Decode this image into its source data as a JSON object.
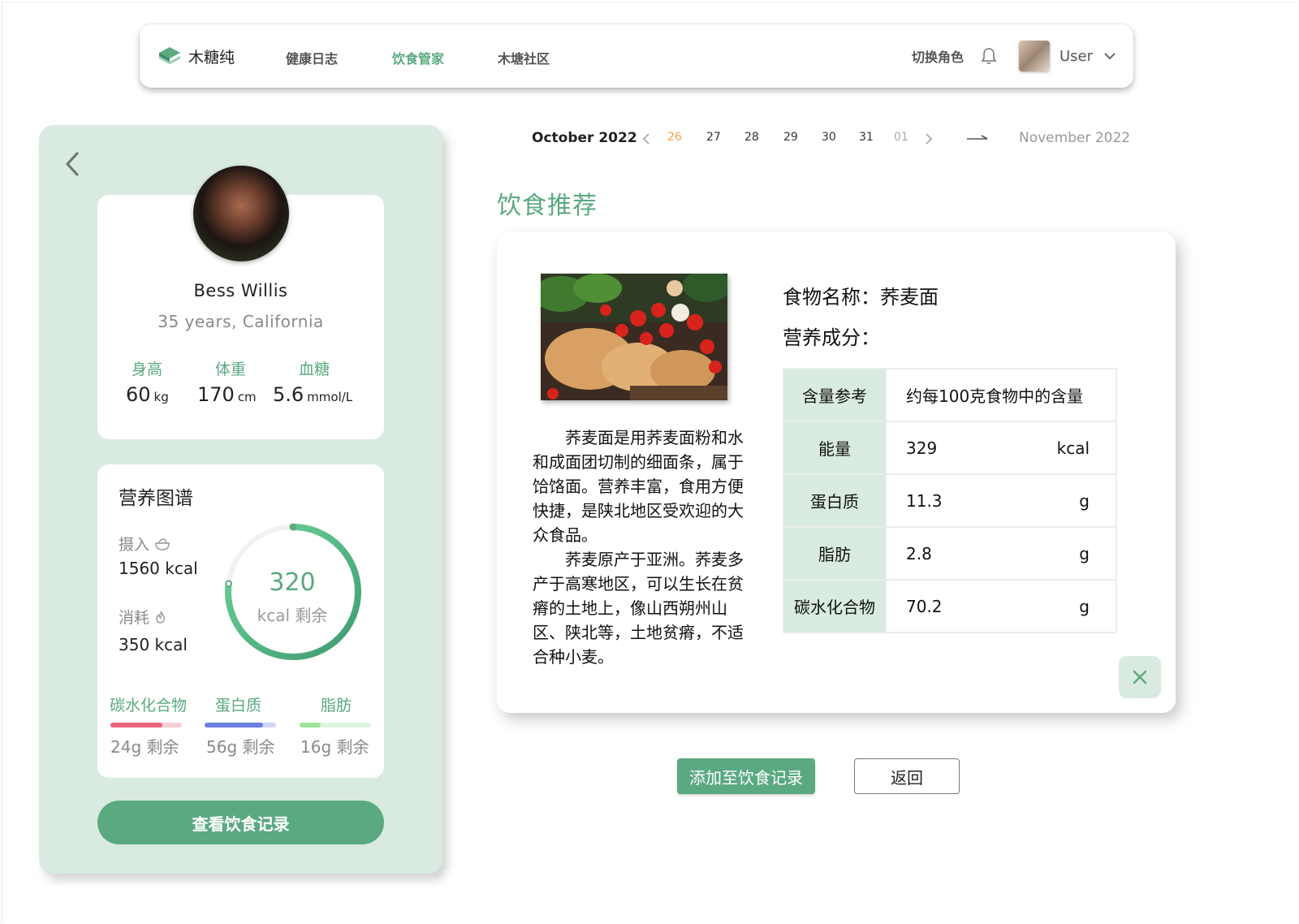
{
  "app": {
    "name": "木糖纯",
    "nav": [
      "健康日志",
      "饮食管家",
      "木塘社区"
    ],
    "switch_role": "切换角色",
    "user": "User"
  },
  "profile": {
    "name": "Bess Willis",
    "info": "35 years, California",
    "stats": [
      {
        "label": "身高",
        "value": "60",
        "unit": "kg"
      },
      {
        "label": "体重",
        "value": "170",
        "unit": "cm"
      },
      {
        "label": "血糖",
        "value": "5.6",
        "unit": "mmol/L"
      }
    ]
  },
  "nutrition": {
    "title": "营养图谱",
    "intake_label": "摄入",
    "intake_value": "1560 kcal",
    "burn_label": "消耗",
    "burn_value": "350 kcal",
    "remaining": "320",
    "remaining_label": "kcal 剩余",
    "remaining_fraction": 0.77,
    "macros": [
      {
        "label": "碳水化合物",
        "remaining": "24g 剩余",
        "color": "#e8637a",
        "track": "#f6cdd4",
        "fill": 0.73
      },
      {
        "label": "蛋白质",
        "remaining": "56g 剩余",
        "color": "#6a7fe0",
        "track": "#cfd6f6",
        "fill": 0.82
      },
      {
        "label": "脂肪",
        "remaining": "16g 剩余",
        "color": "#9ee39a",
        "track": "#dff6dd",
        "fill": 0.3
      }
    ],
    "view_button": "查看饮食记录"
  },
  "dates": {
    "month_from": "October 2022",
    "month_to": "November  2022",
    "days": [
      "26",
      "27",
      "28",
      "29",
      "30",
      "31",
      "01"
    ],
    "active": "26"
  },
  "recommend": {
    "title": "饮食推荐",
    "food_name": "食物名称：荞麦面",
    "nutri_heading": "营养成分：",
    "desc": [
      "荞麦面是用荞麦面粉和水和成面团切制的细面条，属于饸饹面。营养丰富，食用方便快捷，是陕北地区受欢迎的大众食品。",
      "荞麦原产于亚洲。荞麦多产于高寒地区，可以生长在贫瘠的土地上，像山西朔州山区、陕北等，土地贫瘠，不适合种小麦。"
    ],
    "table_header": {
      "k": "含量参考",
      "v": "约每100克食物中的含量"
    },
    "table": [
      {
        "k": "能量",
        "v": "329",
        "u": "kcal"
      },
      {
        "k": "蛋白质",
        "v": "11.3",
        "u": "g"
      },
      {
        "k": "脂肪",
        "v": "2.8",
        "u": "g"
      },
      {
        "k": "碳水化合物",
        "v": "70.2",
        "u": "g"
      }
    ],
    "add_button": "添加至饮食记录",
    "back_button": "返回"
  },
  "colors": {
    "accent": "#5aa980",
    "panel": "#d9ebe1",
    "date_active": "#f0a050"
  }
}
